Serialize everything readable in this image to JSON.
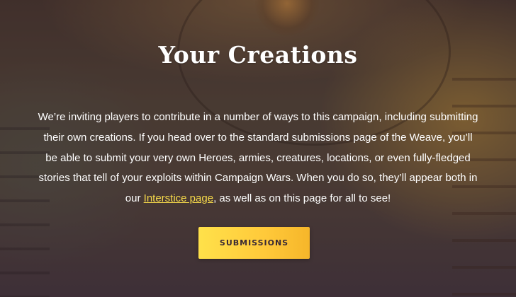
{
  "section": {
    "title": "Your Creations",
    "paragraph": {
      "before_link": "We’re inviting players to contribute in a number of ways to this campaign, including submitting their own creations. If you head over to the standard submissions page of the Weave, you’ll be able to submit your very own Heroes, armies, creatures, locations, or even fully-fledged stories that tell of your exploits within Campaign Wars. When you do so, they’ll appear both in our ",
      "link_label": "Interstice page",
      "after_link": ", as well as on this page for all to see!"
    },
    "button_label": "SUBMISSIONS"
  },
  "colors": {
    "link": "#f6d94a",
    "button_start": "#ffe14a",
    "button_end": "#f6b62a",
    "button_text": "#3a2a35"
  }
}
